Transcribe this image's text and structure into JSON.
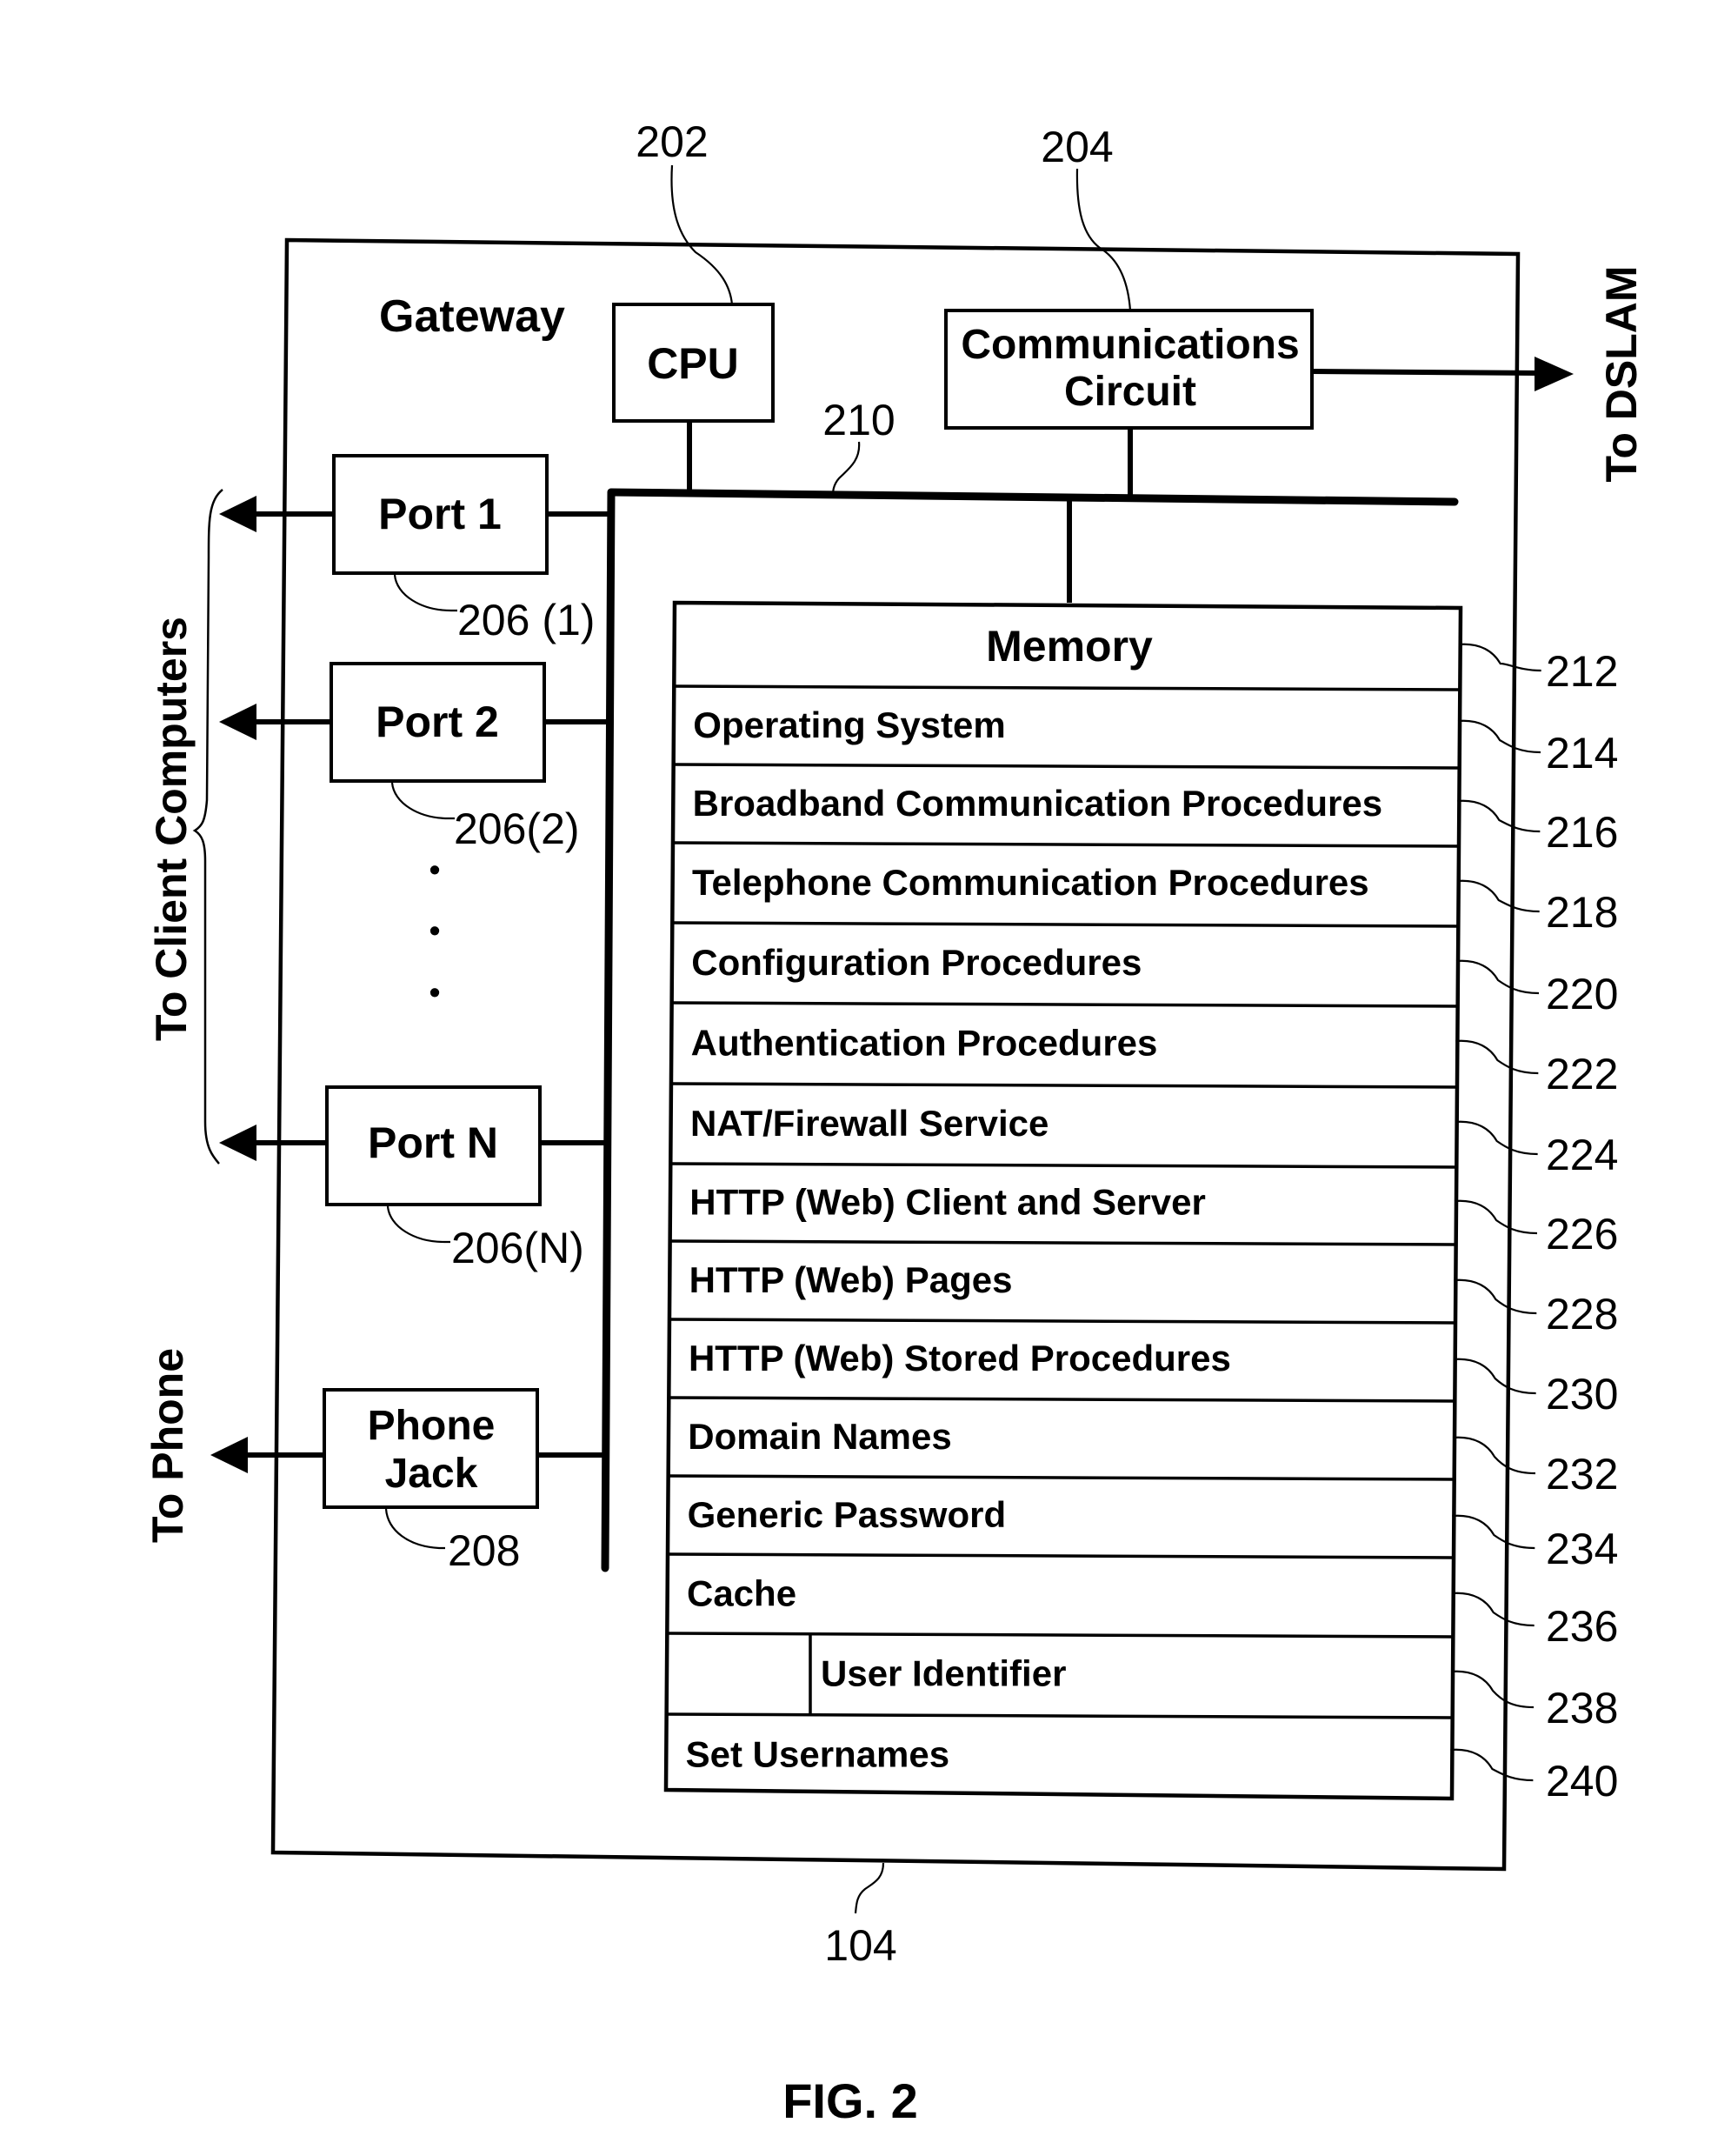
{
  "figure": {
    "caption": "FIG. 2",
    "gateway": {
      "title": "Gateway",
      "ref": "104"
    },
    "cpu": {
      "label": "CPU",
      "ref": "202"
    },
    "comms": {
      "label_line1": "Communications",
      "label_line2": "Circuit",
      "ref": "204"
    },
    "bus": {
      "ref": "210"
    },
    "to_dslam": "To DSLAM",
    "to_client_computers": "To Client Computers",
    "to_phone": "To Phone",
    "ports": [
      {
        "label": "Port 1",
        "ref": "206 (1)"
      },
      {
        "label": "Port 2",
        "ref": "206(2)"
      },
      {
        "label": "Port N",
        "ref": "206(N)"
      }
    ],
    "ellipsis_dots": [
      "•",
      "•",
      "•"
    ],
    "phone_jack": {
      "label_line1": "Phone",
      "label_line2": "Jack",
      "ref": "208"
    },
    "memory": {
      "title": "Memory",
      "title_ref": "212",
      "rows": [
        {
          "label": "Operating System",
          "ref": "214",
          "indent": false
        },
        {
          "label": "Broadband Communication Procedures",
          "ref": "216",
          "indent": false
        },
        {
          "label": "Telephone Communication Procedures",
          "ref": "218",
          "indent": false
        },
        {
          "label": "Configuration Procedures",
          "ref": "220",
          "indent": false
        },
        {
          "label": "Authentication Procedures",
          "ref": "222",
          "indent": false
        },
        {
          "label": "NAT/Firewall Service",
          "ref": "224",
          "indent": false
        },
        {
          "label": "HTTP (Web) Client and Server",
          "ref": "226",
          "indent": false
        },
        {
          "label": "HTTP (Web) Pages",
          "ref": "228",
          "indent": false
        },
        {
          "label": "HTTP (Web) Stored Procedures",
          "ref": "230",
          "indent": false
        },
        {
          "label": "Domain Names",
          "ref": "232",
          "indent": false
        },
        {
          "label": "Generic Password",
          "ref": "234",
          "indent": false
        },
        {
          "label": "Cache",
          "ref": "236",
          "indent": false
        },
        {
          "label": "User Identifier",
          "ref": "238",
          "indent": true
        },
        {
          "label": "Set Usernames",
          "ref": "240",
          "indent": false
        }
      ]
    }
  }
}
